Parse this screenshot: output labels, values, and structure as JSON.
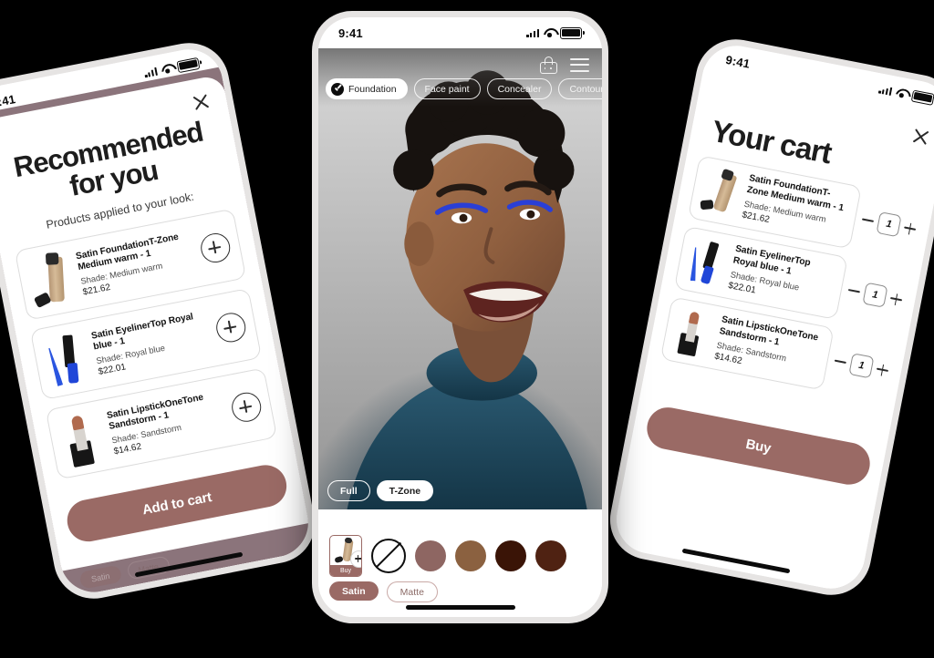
{
  "status_bar": {
    "time": "9:41"
  },
  "left_phone": {
    "screen_name": "Recommended for you",
    "title": "Recommended for you",
    "subtitle": "Products applied to your look:",
    "close_label": "close-icon",
    "products": [
      {
        "name": "Satin FoundationT-Zone Medium warm - 1",
        "shade": "Shade: Medium warm",
        "price": "$21.62",
        "art": "foundation",
        "add_label": "+"
      },
      {
        "name": "Satin EyelinerTop Royal blue - 1",
        "shade": "Shade: Royal blue",
        "price": "$22.01",
        "art": "eyeliner",
        "add_label": "+"
      },
      {
        "name": "Satin LipstickOneTone Sandstorm - 1",
        "shade": "Shade: Sandstorm",
        "price": "$14.62",
        "art": "lipstick",
        "add_label": "+"
      }
    ],
    "cta_label": "Add to cart",
    "background_pills": [
      "Satin",
      "Matte"
    ]
  },
  "center_phone": {
    "screen_name": "Virtual try-on camera",
    "categories": [
      {
        "label": "Foundation",
        "selected": true
      },
      {
        "label": "Face paint",
        "selected": false
      },
      {
        "label": "Concealer",
        "selected": false
      },
      {
        "label": "Contour",
        "selected": false
      }
    ],
    "coverage": [
      {
        "label": "Full",
        "selected": false
      },
      {
        "label": "T-Zone",
        "selected": true
      }
    ],
    "buy_tile": {
      "label": "Buy",
      "badge": "+"
    },
    "no_shade_label": "no-shade",
    "shades": [
      {
        "name": "Rose brown",
        "hex": "#8e6662"
      },
      {
        "name": "Tan",
        "hex": "#8b6140"
      },
      {
        "name": "Dark espresso",
        "hex": "#3a1406"
      },
      {
        "name": "Deep brown",
        "hex": "#4f2212"
      }
    ],
    "finishes": [
      {
        "label": "Satin",
        "selected": true
      },
      {
        "label": "Matte",
        "selected": false
      }
    ],
    "icons": {
      "cart": "shopping-bag-icon",
      "menu": "hamburger-menu-icon"
    }
  },
  "right_phone": {
    "screen_name": "Your cart",
    "title": "Your cart",
    "close_label": "close-icon",
    "items": [
      {
        "name": "Satin FoundationT-Zone Medium warm - 1",
        "shade": "Shade: Medium warm",
        "price": "$21.62",
        "qty": "1",
        "art": "foundation"
      },
      {
        "name": "Satin EyelinerTop Royal blue - 1",
        "shade": "Shade: Royal blue",
        "price": "$22.01",
        "qty": "1",
        "art": "eyeliner"
      },
      {
        "name": "Satin LipstickOneTone Sandstorm - 1",
        "shade": "Shade: Sandstorm",
        "price": "$14.62",
        "qty": "1",
        "art": "lipstick"
      }
    ],
    "decrement_label": "−",
    "increment_label": "+",
    "cta_label": "Buy"
  },
  "colors": {
    "accent": "#9a6a65",
    "overlay": "#8b747b",
    "text": "#1d1d1d"
  }
}
